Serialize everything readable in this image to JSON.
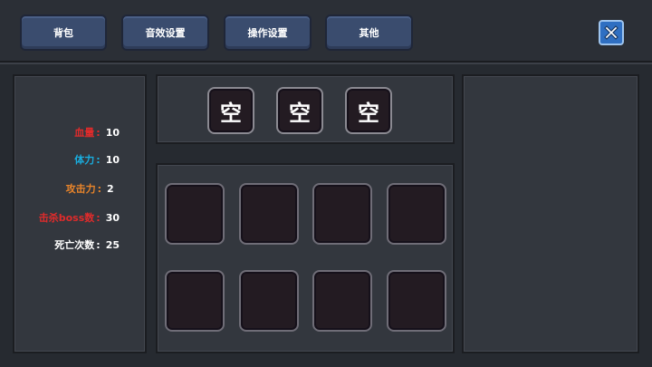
{
  "tabs": {
    "bag": "背包",
    "sound": "音效设置",
    "control": "操作设置",
    "other": "其他"
  },
  "close": {
    "icon": "close-x-icon",
    "color": "#2f6fc2"
  },
  "stats": [
    {
      "label": "血量",
      "value": "10",
      "color": "#e02b2b"
    },
    {
      "label": "体力",
      "value": "10",
      "color": "#19aee0"
    },
    {
      "label": "攻击力",
      "value": "2",
      "color": "#e8842a"
    },
    {
      "label": "击杀boss数",
      "value": "30",
      "color": "#e02b2b"
    },
    {
      "label": "死亡次数",
      "value": "25",
      "color": "#ffffff"
    }
  ],
  "colon": ":",
  "equip_slots": [
    "空",
    "空",
    "空"
  ],
  "inventory_slots": 8
}
